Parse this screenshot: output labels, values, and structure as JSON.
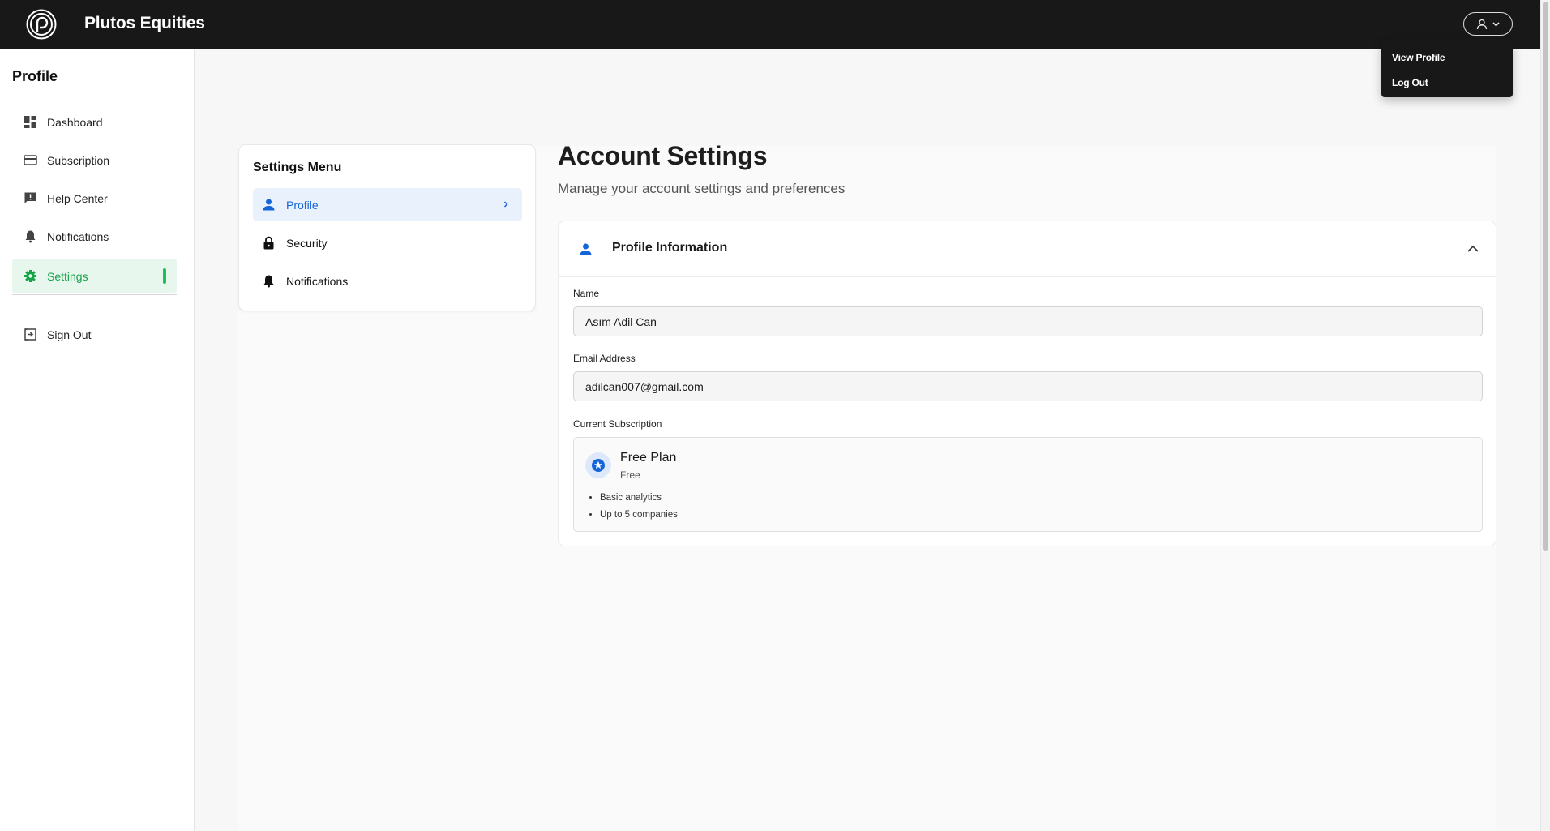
{
  "header": {
    "brand": "Plutos Equities",
    "logo_icon": "plutos-logo-icon",
    "user_menu_icon": "user-icon"
  },
  "user_dropdown": {
    "items": [
      {
        "label": "View Profile"
      },
      {
        "label": "Log Out"
      }
    ]
  },
  "sidebar": {
    "title": "Profile",
    "items": [
      {
        "label": "Dashboard",
        "icon": "dashboard-icon"
      },
      {
        "label": "Subscription",
        "icon": "credit-card-icon"
      },
      {
        "label": "Help Center",
        "icon": "feedback-icon"
      },
      {
        "label": "Notifications",
        "icon": "bell-icon"
      },
      {
        "label": "Settings",
        "icon": "gear-icon",
        "active": true
      },
      {
        "label": "Sign Out",
        "icon": "sign-out-icon"
      }
    ]
  },
  "settings_menu": {
    "title": "Settings Menu",
    "items": [
      {
        "label": "Profile",
        "icon": "person-icon",
        "active": true
      },
      {
        "label": "Security",
        "icon": "lock-icon"
      },
      {
        "label": "Notifications",
        "icon": "bell-icon"
      }
    ]
  },
  "page": {
    "title": "Account Settings",
    "subtitle": "Manage your account settings and preferences"
  },
  "profile_info": {
    "title": "Profile Information",
    "name_label": "Name",
    "name_value": "Asım Adil Can",
    "email_label": "Email Address",
    "email_value": "adilcan007@gmail.com",
    "subscription_label": "Current Subscription",
    "plan": {
      "name": "Free Plan",
      "price": "Free",
      "features": [
        "Basic analytics",
        "Up to 5 companies"
      ]
    }
  },
  "colors": {
    "topbar": "#181818",
    "accent_green": "#17a34a",
    "accent_blue": "#1565d8"
  }
}
